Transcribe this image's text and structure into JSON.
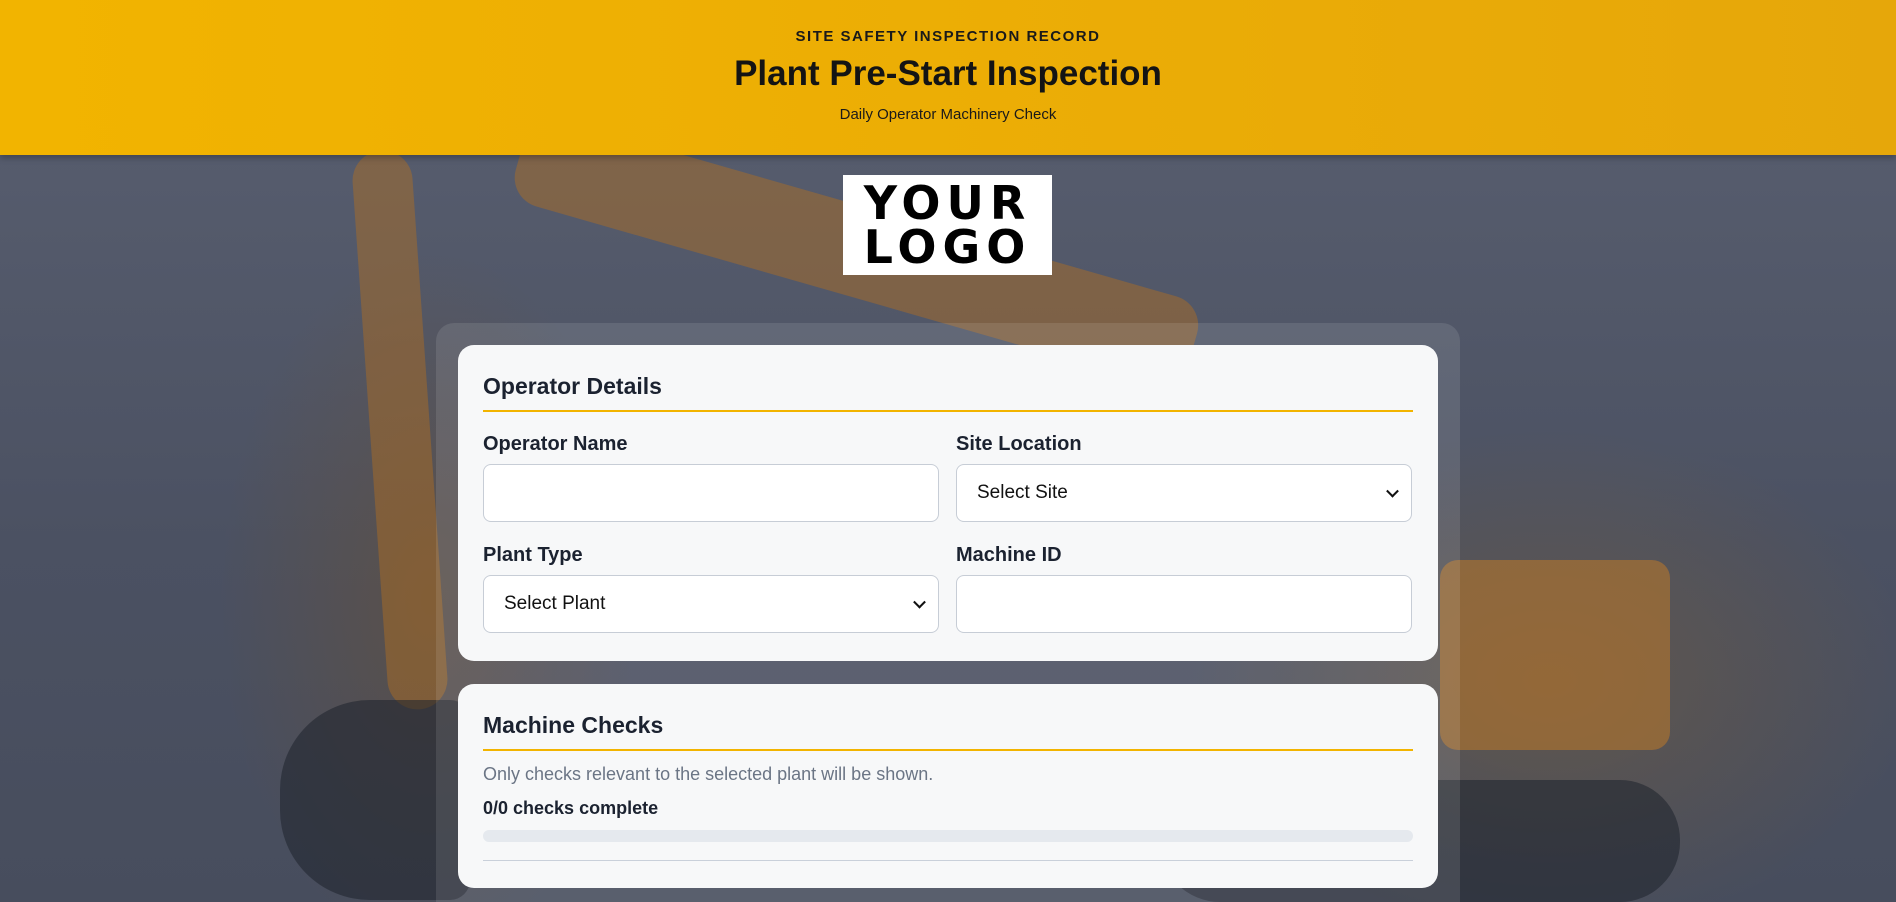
{
  "header": {
    "eyebrow": "SITE SAFETY INSPECTION RECORD",
    "title": "Plant Pre-Start Inspection",
    "subtitle": "Daily Operator Machinery Check"
  },
  "logo": {
    "line1": "YOUR",
    "line2": "LOGO"
  },
  "operator_details": {
    "title": "Operator Details",
    "fields": {
      "operator_name": {
        "label": "Operator Name",
        "value": ""
      },
      "site_location": {
        "label": "Site Location",
        "selected": "Select Site"
      },
      "plant_type": {
        "label": "Plant Type",
        "selected": "Select Plant"
      },
      "machine_id": {
        "label": "Machine ID",
        "value": ""
      }
    }
  },
  "machine_checks": {
    "title": "Machine Checks",
    "helper": "Only checks relevant to the selected plant will be shown.",
    "progress_text": "0/0 checks complete",
    "progress_fraction": 0
  },
  "colors": {
    "accent": "#f2b400",
    "header_bg": "#f2b400",
    "background": "#4e5566",
    "card": "#f7f8f9"
  }
}
